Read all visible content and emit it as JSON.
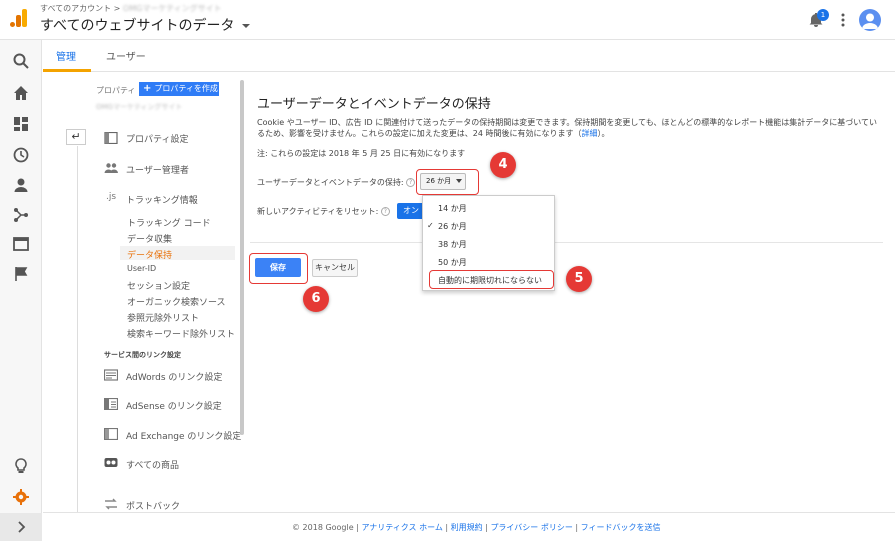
{
  "header": {
    "breadcrumb_prefix": "すべてのアカウント > ",
    "breadcrumb_account": "OMGマーケティングサイト",
    "property_title": "すべてのウェブサイトのデータ",
    "notification_count": "1"
  },
  "tabs": {
    "admin": "管理",
    "user": "ユーザー"
  },
  "property_nav": {
    "label": "プロパティ",
    "create_button": "プロパティを作成",
    "property_name": "OMGマーケティングサイト",
    "items": {
      "property_settings": "プロパティ設定",
      "user_management": "ユーザー管理者",
      "tracking_info": "トラッキング情報",
      "tracking_code": "トラッキング コード",
      "data_collection": "データ収集",
      "data_retention": "データ保持",
      "user_id": "User-ID",
      "session_settings": "セッション設定",
      "organic_sources": "オーガニック検索ソース",
      "referral_exclusion": "参照元除外リスト",
      "search_term_exclusion": "検索キーワード除外リスト",
      "product_linking_section": "サービス間のリンク設定",
      "adwords_linking": "AdWords のリンク設定",
      "adsense_linking": "AdSense のリンク設定",
      "adexchange_linking": "Ad Exchange のリンク設定",
      "all_products": "すべての商品",
      "postbacks": "ポストバック"
    },
    "js_icon_text": ".js"
  },
  "main": {
    "title": "ユーザーデータとイベントデータの保持",
    "description": "Cookie やユーザー ID、広告 ID に関連付けて送ったデータの保持期間は変更できます。保持期間を変更しても、ほとんどの標準的なレポート機能は集計データに基づいているため、影響を受けません。これらの設定に加えた変更は、24 時間後に有効になります（",
    "description_link": "詳細",
    "description_end": "）。",
    "note": "注: これらの設定は 2018 年 5 月 25 日に有効になります",
    "retention_label": "ユーザーデータとイベントデータの保持:",
    "retention_value": "26 か月",
    "reset_label": "新しいアクティビティをリセット:",
    "reset_toggle": "オン",
    "help_glyph": "?",
    "save": "保存",
    "cancel": "キャンセル"
  },
  "dropdown": {
    "options": [
      "14 か月",
      "26 か月",
      "38 か月",
      "50 か月",
      "自動的に期限切れにならない"
    ],
    "selected": "26 か月",
    "check": "✓"
  },
  "annotations": [
    "4",
    "5",
    "6"
  ],
  "footer": {
    "copyright": "© 2018 Google | ",
    "links": [
      "アナリティクス ホーム",
      "利用規約",
      "プライバシー ポリシー",
      "フィードバックを送信"
    ],
    "separator": " | "
  },
  "colors": {
    "accent": "#1a73e8",
    "active_orange": "#e8710a",
    "annotation_red": "#e53935",
    "save_blue": "#3b82f6"
  },
  "icons": [
    "analytics-logo-icon",
    "bell-icon",
    "kebab-menu-icon",
    "account-avatar-icon",
    "search-icon",
    "home-icon",
    "dashboard-icon",
    "clock-icon",
    "person-icon",
    "acquisition-icon",
    "behavior-icon",
    "flag-icon",
    "lightbulb-icon",
    "gear-icon",
    "chevron-right-icon",
    "back-arrow-icon"
  ]
}
